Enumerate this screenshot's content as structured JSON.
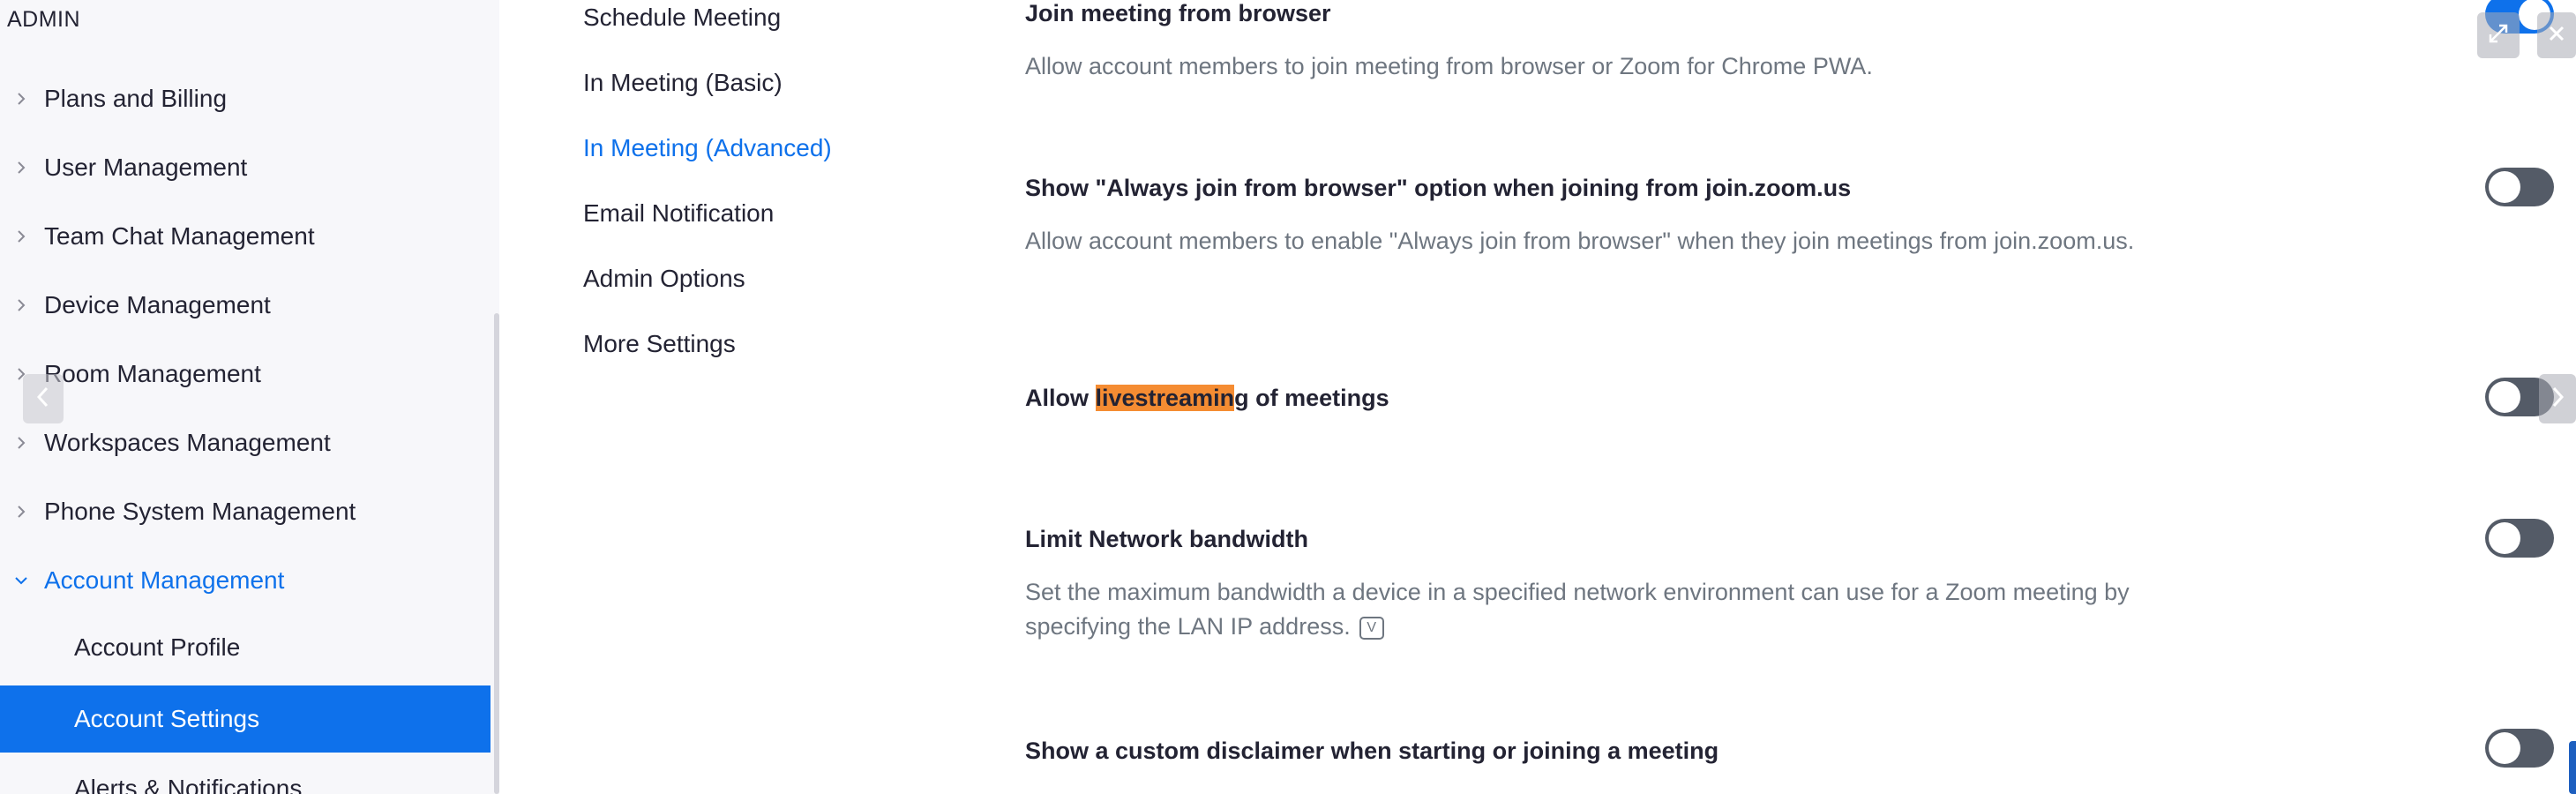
{
  "sidebar": {
    "section_label": "ADMIN",
    "items": [
      {
        "label": "Plans and Billing"
      },
      {
        "label": "User Management"
      },
      {
        "label": "Team Chat Management"
      },
      {
        "label": "Device Management"
      },
      {
        "label": "Room Management"
      },
      {
        "label": "Workspaces Management"
      },
      {
        "label": "Phone System Management"
      },
      {
        "label": "Account Management"
      }
    ],
    "sub_items": [
      {
        "label": "Account Profile"
      },
      {
        "label": "Account Settings"
      },
      {
        "label": "Alerts & Notifications"
      }
    ]
  },
  "subnav": {
    "items": [
      {
        "label": "Schedule Meeting"
      },
      {
        "label": "In Meeting (Basic)"
      },
      {
        "label": "In Meeting (Advanced)"
      },
      {
        "label": "Email Notification"
      },
      {
        "label": "Admin Options"
      },
      {
        "label": "More Settings"
      }
    ]
  },
  "settings": [
    {
      "title": "Join meeting from browser",
      "description": "Allow account members to join meeting from browser or Zoom for Chrome PWA.",
      "enabled": true
    },
    {
      "title": "Show \"Always join from browser\" option when joining from join.zoom.us",
      "description": "Allow account members to enable \"Always join from browser\" when they join meetings from join.zoom.us.",
      "enabled": false
    },
    {
      "title_prefix": "Allow ",
      "title_highlight": "livestreamin",
      "title_suffix": "g of meetings",
      "enabled": false
    },
    {
      "title": "Limit Network bandwidth",
      "description": "Set the maximum bandwidth a device in a specified network environment can use for a Zoom meeting by specifying the LAN IP address.",
      "info_icon_glyph": "V",
      "enabled": false
    },
    {
      "title": "Show a custom disclaimer when starting or joining a meeting",
      "enabled": false
    }
  ],
  "colors": {
    "accent": "#0e71eb",
    "highlight": "#f58c32",
    "toggle_off": "#545b67",
    "sidebar_bg": "#f7f7fa"
  },
  "icons": {
    "chevron_right": "chevron-right-icon",
    "chevron_down": "chevron-down-icon",
    "expand": "expand-icon",
    "close": "close-icon",
    "carousel_prev": "chevron-left-icon",
    "carousel_next": "chevron-right-icon"
  }
}
